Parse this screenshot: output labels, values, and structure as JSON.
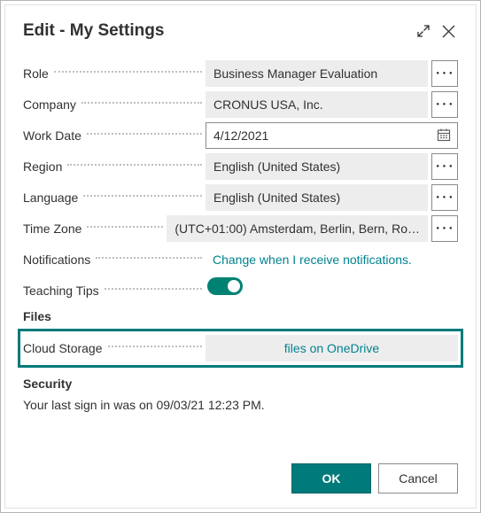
{
  "header": {
    "title": "Edit - My Settings"
  },
  "rows": {
    "role": {
      "label": "Role",
      "value": "Business Manager Evaluation"
    },
    "company": {
      "label": "Company",
      "value": "CRONUS USA, Inc."
    },
    "workdate": {
      "label": "Work Date",
      "value": "4/12/2021"
    },
    "region": {
      "label": "Region",
      "value": "English (United States)"
    },
    "language": {
      "label": "Language",
      "value": "English (United States)"
    },
    "timezone": {
      "label": "Time Zone",
      "value": "(UTC+01:00) Amsterdam, Berlin, Bern, Ro…"
    },
    "notif": {
      "label": "Notifications",
      "value": "Change when I receive notifications."
    },
    "teach": {
      "label": "Teaching Tips"
    },
    "cloud": {
      "label": "Cloud Storage",
      "value": "files on OneDrive"
    }
  },
  "sections": {
    "files": "Files",
    "security": "Security"
  },
  "security_text": "Your last sign in was on 09/03/21 12:23 PM.",
  "buttons": {
    "ok": "OK",
    "cancel": "Cancel"
  },
  "assist_glyph": "● ● ●"
}
